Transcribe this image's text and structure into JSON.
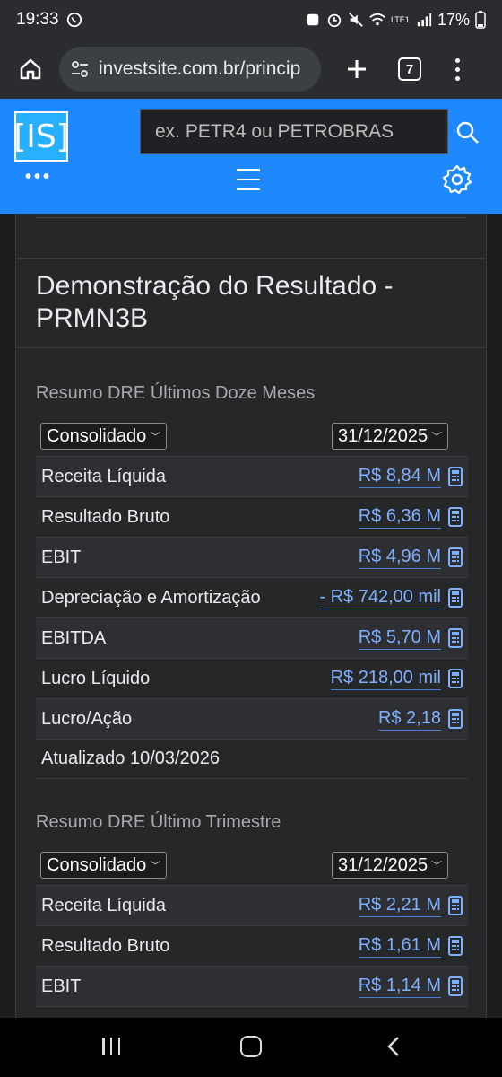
{
  "status_bar": {
    "time": "19:33",
    "battery": "17%",
    "lte": "LTE1"
  },
  "browser": {
    "url": "investsite.com.br/princip",
    "tab_count": "7"
  },
  "site": {
    "logo": "[IS]",
    "search_placeholder": "ex. PETR4 ou PETROBRAS"
  },
  "page": {
    "title": "Demonstração do Resultado - PRMN3B"
  },
  "section_ltm": {
    "title": "Resumo DRE Últimos Doze Meses",
    "select_type": "Consolidado",
    "select_date": "31/12/2025",
    "rows": [
      {
        "label": "Receita Líquida",
        "value": "R$ 8,84 M"
      },
      {
        "label": "Resultado Bruto",
        "value": "R$ 6,36 M"
      },
      {
        "label": "EBIT",
        "value": "R$ 4,96 M"
      },
      {
        "label": "Depreciação e Amortização",
        "value": "- R$ 742,00 mil"
      },
      {
        "label": "EBITDA",
        "value": "R$ 5,70 M"
      },
      {
        "label": "Lucro Líquido",
        "value": "R$ 218,00 mil"
      },
      {
        "label": "Lucro/Ação",
        "value": "R$ 2,18"
      }
    ],
    "updated": "Atualizado 10/03/2026"
  },
  "section_quarter": {
    "title": "Resumo DRE Último Trimestre",
    "select_type": "Consolidado",
    "select_date": "31/12/2025",
    "rows": [
      {
        "label": "Receita Líquida",
        "value": "R$ 2,21 M"
      },
      {
        "label": "Resultado Bruto",
        "value": "R$ 1,61 M"
      },
      {
        "label": "EBIT",
        "value": "R$ 1,14 M"
      }
    ]
  },
  "colors": {
    "header_blue": "#1e88ff",
    "link_blue": "#7fb0ff",
    "card_bg": "#262729"
  }
}
